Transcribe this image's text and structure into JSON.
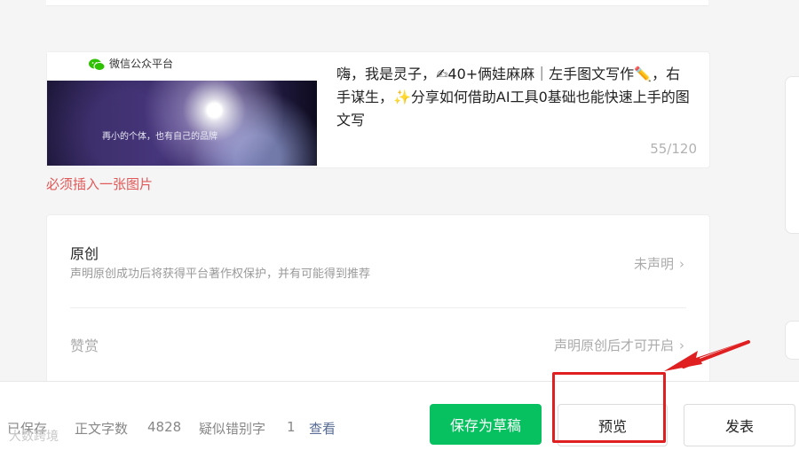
{
  "digest": {
    "cover_brand": "微信公众平台",
    "cover_slogan": "再小的个体，也有自己的品牌",
    "text": "嗨，我是灵子，✍40+俩娃麻麻｜左手图文写作✏️，右手谋生，✨分享如何借助AI工具0基础也能快速上手的图文写",
    "count": "55/120"
  },
  "error_text": "必须插入一张图片",
  "settings": {
    "original": {
      "title": "原创",
      "desc": "声明原创成功后将获得平台著作权保护，并有可能得到推荐",
      "status": "未声明"
    },
    "tip": {
      "title": "赞赏",
      "status": "声明原创后才可开启"
    },
    "chevron": "›"
  },
  "footer": {
    "saved": "已保存",
    "wordcount_label": "正文字数",
    "wordcount_value": "4828",
    "typo_label": "疑似错别字",
    "typo_value": "1",
    "view_link": "查看",
    "save_draft": "保存为草稿",
    "preview": "预览",
    "publish": "发表"
  },
  "watermark": "大数跨境",
  "colors": {
    "primary_green": "#07c160",
    "error_red": "#e15858",
    "link_blue": "#576b95",
    "annotation_red": "#e02020"
  },
  "icons": [
    "wechat-icon",
    "chevron-right-icon",
    "annotation-arrow-icon"
  ]
}
